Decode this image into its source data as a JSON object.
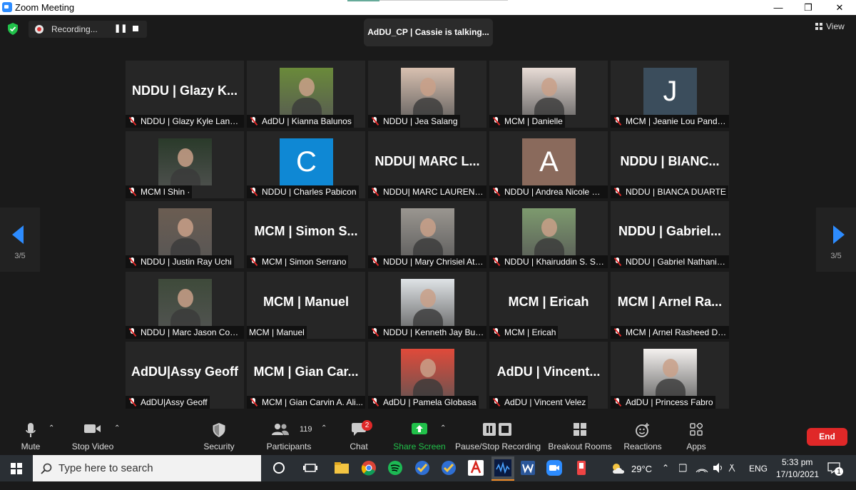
{
  "window": {
    "title": "Zoom Meeting",
    "minimize": "—",
    "maximize": "❐",
    "close": "✕"
  },
  "top": {
    "recording_label": "Recording...",
    "pause_glyph": "❚❚",
    "speaker_banner": "AdDU_CP | Cassie is talking...",
    "view_label": "View"
  },
  "pager": {
    "left": "3/5",
    "right": "3/5"
  },
  "tiles": [
    {
      "big": "NDDU | Glazy K...",
      "name": "NDDU | Glazy Kyle Landero"
    },
    {
      "photo": "#6a8a3a",
      "name": "AdDU | Kianna Balunos"
    },
    {
      "photo": "#d8c0b0",
      "name": "NDDU | Jea Salang"
    },
    {
      "photo": "#e8dcd6",
      "name": "MCM | Danielle"
    },
    {
      "avatar": "J",
      "avatar_color": "#3b4d5c",
      "name": "MCM | Jeanie Lou Pandero"
    },
    {
      "photo": "#2a3a2a",
      "name": "MCM l Shin ·"
    },
    {
      "avatar": "C",
      "avatar_color": "#0f88d4",
      "name": "NDDU | Charles Pabicon"
    },
    {
      "big": "NDDU| MARC L...",
      "name": "NDDU| MARC LAUREN P..."
    },
    {
      "avatar": "A",
      "avatar_color": "#8a6a5c",
      "name": "NDDU | Andrea Nicole Hi..."
    },
    {
      "big": "NDDU | BIANC...",
      "name": "NDDU | BIANCA DUARTE"
    },
    {
      "photo": "#6b5d52",
      "name": "NDDU | Justin Ray Uchi"
    },
    {
      "big": "MCM | Simon S...",
      "name": "MCM | Simon Serrano"
    },
    {
      "photo": "#9a9690",
      "name": "NDDU | Mary Chrisiel Ata..."
    },
    {
      "photo": "#7d9a6e",
      "name": "NDDU | Khairuddin S. Sal..."
    },
    {
      "big": "NDDU | Gabriel...",
      "name": "NDDU | Gabriel Nathanie..."
    },
    {
      "photo": "#3e4a3a",
      "name": "NDDU | Marc Jason Com..."
    },
    {
      "big": "MCM | Manuel",
      "name": "MCM | Manuel",
      "nomic": true
    },
    {
      "photo": "#dfe3e6",
      "name": "NDDU | Kenneth Jay Bue..."
    },
    {
      "big": "MCM | Ericah",
      "name": "MCM | Ericah"
    },
    {
      "big": "MCM | Arnel Ra...",
      "name": "MCM | Arnel Rasheed De..."
    },
    {
      "big": "AdDU|Assy Geoff",
      "name": "AdDU|Assy Geoff"
    },
    {
      "big": "MCM | Gian Car...",
      "name": "MCM | Gian Carvin A. Ali..."
    },
    {
      "photo": "#e04a3a",
      "name": "AdDU | Pamela Globasa"
    },
    {
      "big": "AdDU | Vincent...",
      "name": "AdDU | Vincent Velez"
    },
    {
      "photo": "#f4f1ef",
      "name": "AdDU | Princess Fabro"
    }
  ],
  "toolbar": {
    "mute": "Mute",
    "stop_video": "Stop Video",
    "security": "Security",
    "participants": "Participants",
    "participants_count": "119",
    "chat": "Chat",
    "chat_badge": "2",
    "share_screen": "Share Screen",
    "pause_stop_recording": "Pause/Stop Recording",
    "breakout_rooms": "Breakout Rooms",
    "reactions": "Reactions",
    "apps": "Apps",
    "end": "End",
    "share_color": "#21c14a",
    "end_color": "#e02828"
  },
  "taskbar": {
    "search_placeholder": "Type here to search",
    "weather_temp": "29°C",
    "lang": "ENG",
    "time": "5:33 pm",
    "date": "17/10/2021",
    "notif_count": "1"
  }
}
